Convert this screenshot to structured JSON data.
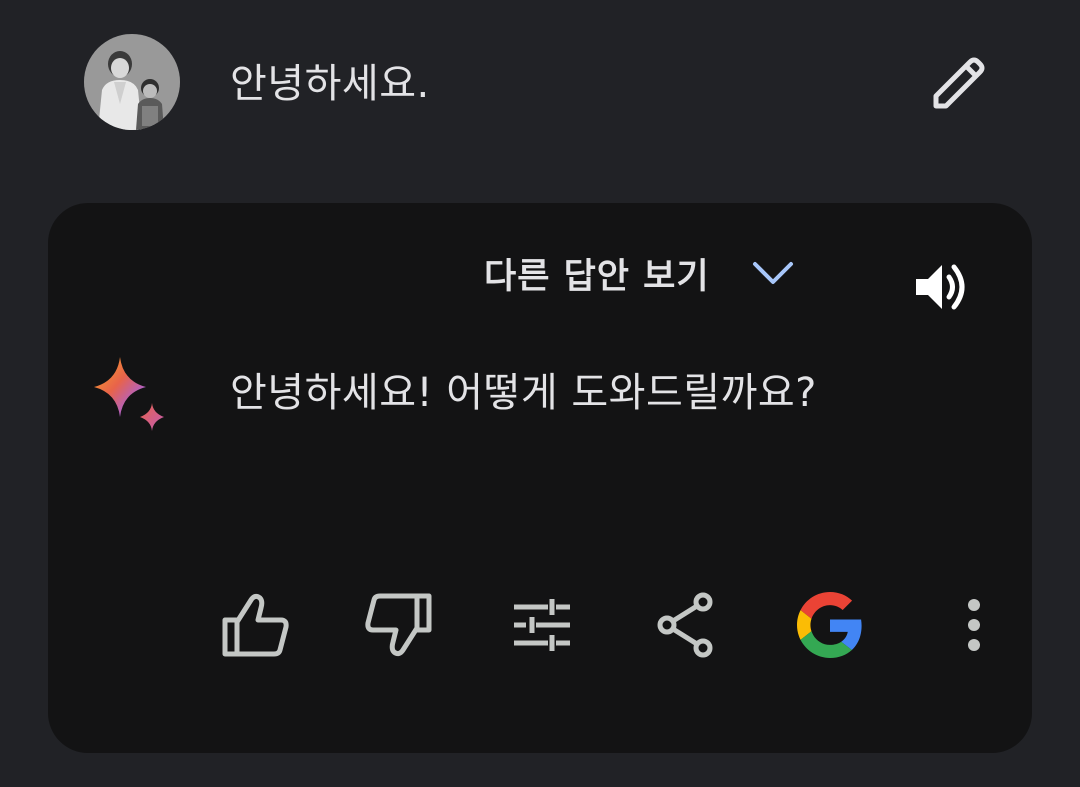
{
  "user": {
    "message": "안녕하세요.",
    "avatar_icon": "avatar-photo",
    "edit_icon": "pencil-icon"
  },
  "response": {
    "drafts_label": "다른 답안 보기",
    "drafts_icon": "chevron-down-icon",
    "speaker_icon": "volume-icon",
    "sparkle_icon": "gemini-sparkle-icon",
    "text": "안녕하세요! 어떻게 도와드릴까요?"
  },
  "actions": [
    {
      "name": "thumbs-up",
      "icon": "thumbs-up-icon"
    },
    {
      "name": "thumbs-down",
      "icon": "thumbs-down-icon"
    },
    {
      "name": "modify-response",
      "icon": "sliders-icon"
    },
    {
      "name": "share",
      "icon": "share-icon"
    },
    {
      "name": "google-search",
      "icon": "google-logo-icon"
    },
    {
      "name": "more-options",
      "icon": "more-vertical-icon"
    }
  ],
  "colors": {
    "background": "#212226",
    "card": "#131314",
    "text": "#e3e3e6",
    "icon": "#c4c7c5",
    "chevron": "#a8c7fa",
    "google_blue": "#4285f4",
    "google_red": "#ea4335",
    "google_yellow": "#fbbc05",
    "google_green": "#34a853"
  }
}
